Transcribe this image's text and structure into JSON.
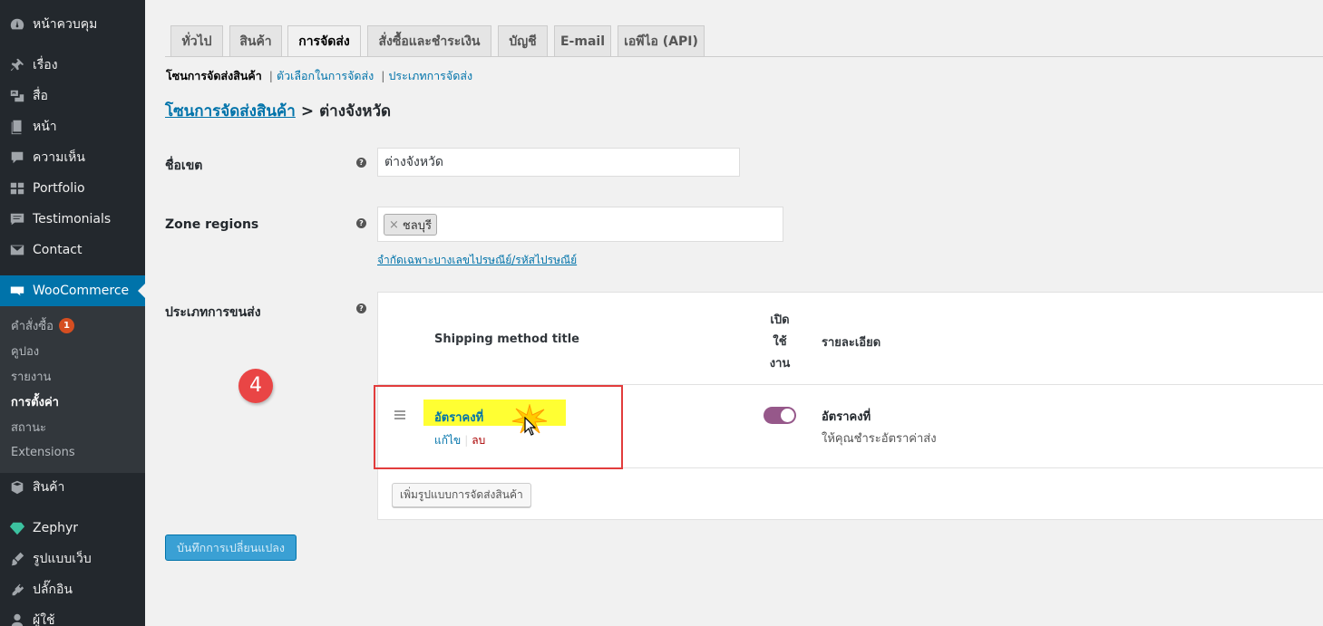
{
  "sidebar": {
    "items": [
      {
        "label": "หน้าควบคุม",
        "icon": "dashboard-icon"
      },
      {
        "label": "เรื่อง",
        "icon": "pin-icon"
      },
      {
        "label": "สื่อ",
        "icon": "media-icon"
      },
      {
        "label": "หน้า",
        "icon": "page-icon"
      },
      {
        "label": "ความเห็น",
        "icon": "comment-icon"
      },
      {
        "label": "Portfolio",
        "icon": "portfolio-icon"
      },
      {
        "label": "Testimonials",
        "icon": "testimonial-icon"
      },
      {
        "label": "Contact",
        "icon": "mail-icon"
      },
      {
        "label": "WooCommerce",
        "icon": "woocommerce-icon"
      },
      {
        "label": "สินค้า",
        "icon": "box-icon"
      },
      {
        "label": "Zephyr",
        "icon": "gem-icon"
      },
      {
        "label": "รูปแบบเว็บ",
        "icon": "brush-icon"
      },
      {
        "label": "ปลั๊กอิน",
        "icon": "plugin-icon"
      },
      {
        "label": "ผู้ใช้",
        "icon": "user-icon"
      }
    ],
    "woo_submenu": [
      {
        "label": "คำสั่งซื้อ",
        "badge": "1"
      },
      {
        "label": "คูปอง"
      },
      {
        "label": "รายงาน"
      },
      {
        "label": "การตั้งค่า"
      },
      {
        "label": "สถานะ"
      },
      {
        "label": "Extensions"
      }
    ],
    "active_color": "#0073aa",
    "badge_color": "#d54e21"
  },
  "tabs": [
    "ทั่วไป",
    "สินค้า",
    "การจัดส่ง",
    "สั่งซื้อและชำระเงิน",
    "บัญชี",
    "E-mail",
    "เอพีไอ (API)"
  ],
  "active_tab": "การจัดส่ง",
  "subnav": {
    "current": "โซนการจัดส่งสินค้า",
    "links": [
      "ตัวเลือกในการจัดส่ง",
      "ประเภทการจัดส่ง"
    ],
    "separator": "|"
  },
  "breadcrumb": {
    "link": "โซนการจัดส่งสินค้า",
    "separator": ">",
    "current": "ต่างจังหวัด"
  },
  "form": {
    "zone_name_label": "ชื่อเขต",
    "zone_name_value": "ต่างจังหวัด",
    "zone_regions_label": "Zone regions",
    "region_chip_remove": "×",
    "region_chip": "ชลบุรี",
    "postcode_link": "จำกัดเฉพาะบางเลขไปรษณีย์/รหัสไปรษณีย์",
    "shipping_methods_label": "ประเภทการขนส่ง",
    "help_glyph": "?"
  },
  "methods_table": {
    "col_title": "Shipping method title",
    "col_enabled_lines": [
      "เปิด",
      "ใช้",
      "งาน"
    ],
    "col_description": "รายละเอียด",
    "rows": [
      {
        "title": "อัตราคงที่",
        "edit_label": "แก้ไข",
        "actions_separator": "|",
        "delete_label": "ลบ",
        "enabled": true,
        "desc_title": "อัตราคงที่",
        "desc_text": "ให้คุณชำระอัตราค่าส่ง"
      }
    ],
    "add_button": "เพิ่มรูปแบบการจัดส่งสินค้า",
    "toggle_color": "#96588a"
  },
  "save_button": "บันทึกการเปลี่ยนแปลง",
  "annotation": {
    "step_number": "4",
    "highlight_color": "#ffff33",
    "box_color": "#e23c3c"
  }
}
